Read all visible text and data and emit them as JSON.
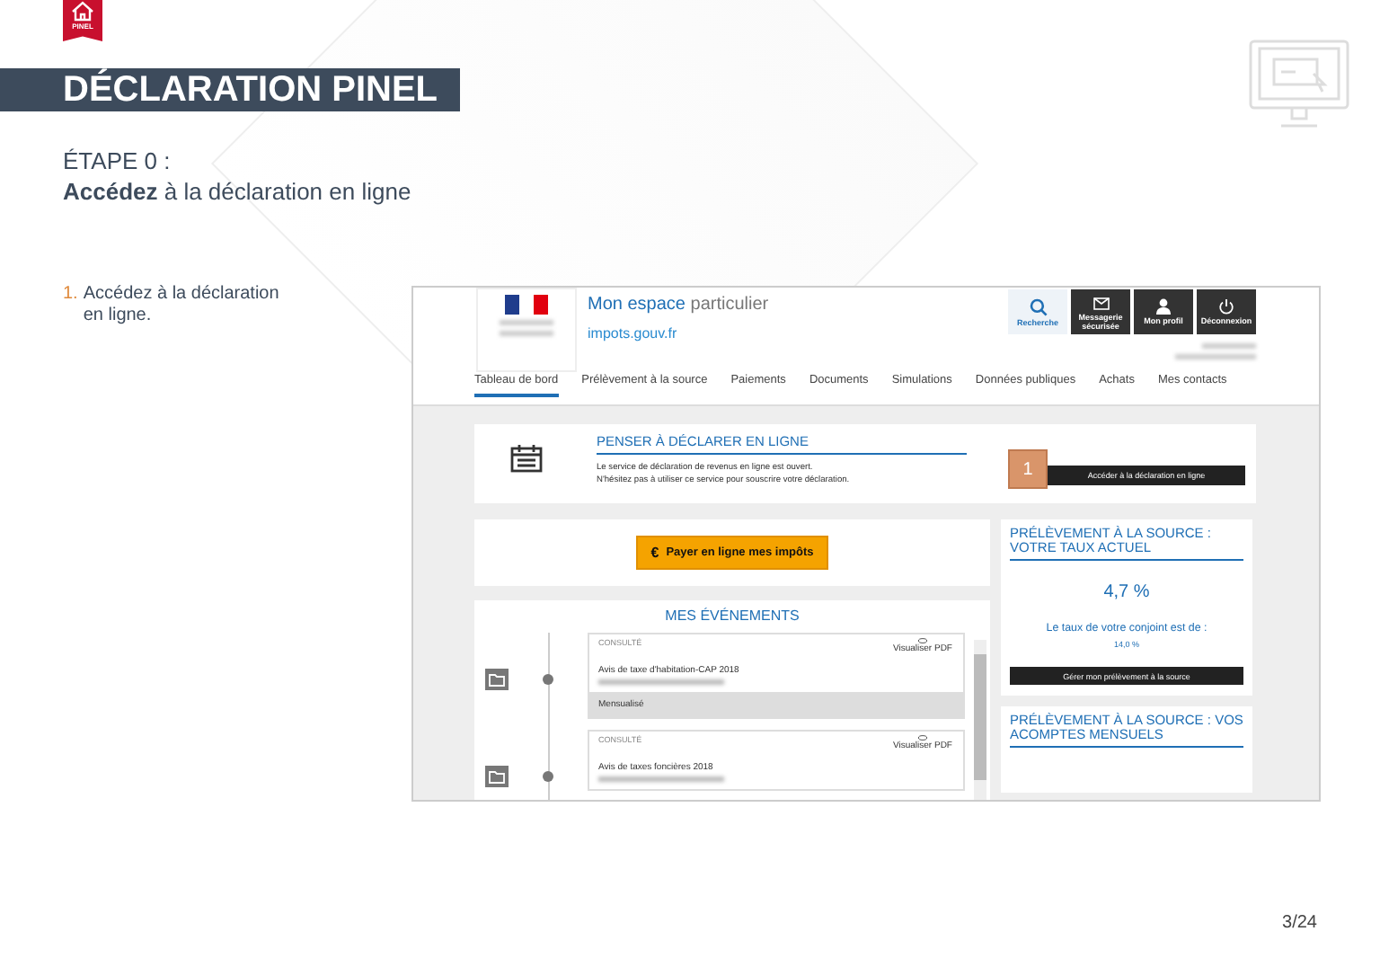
{
  "badge": {
    "label": "PINEL"
  },
  "title": "DÉCLARATION PINEL",
  "step": {
    "heading": "ÉTAPE 0 :",
    "subtitle": "**Accédez** à la déclaration en ligne"
  },
  "instructions": [
    {
      "number": "1.",
      "text": "Accédez à la déclaration en ligne."
    }
  ],
  "screenshot": {
    "header": {
      "site_title": "**Mon espace** particulier",
      "site_name": "impots.gouv.fr"
    },
    "header_buttons": [
      {
        "label": "Recherche",
        "kind": "search"
      },
      {
        "label": "Messagerie sécurisée",
        "kind": "mail"
      },
      {
        "label": "Mon profil",
        "kind": "profile"
      },
      {
        "label": "Déconnexion",
        "kind": "power"
      }
    ],
    "nav": [
      {
        "label": "Tableau de bord",
        "selected": true
      },
      {
        "label": "Prélèvement à la source",
        "selected": false
      },
      {
        "label": "Paiements",
        "selected": false
      },
      {
        "label": "Documents",
        "selected": false
      },
      {
        "label": "Simulations",
        "selected": false
      },
      {
        "label": "Données publiques",
        "selected": false
      },
      {
        "label": "Achats",
        "selected": false
      },
      {
        "label": "Mes contacts",
        "selected": false
      }
    ],
    "declare_card": {
      "title": "PENSER À DÉCLARER EN LIGNE",
      "text": [
        "Le service de déclaration de revenus en ligne est ouvert.",
        "N'hésitez pas à utiliser ce service pour souscrire votre déclaration."
      ],
      "step_badge": "1",
      "button": "Accéder à la déclaration en ligne"
    },
    "pay": {
      "icon": "€",
      "button": "Payer en ligne mes impôts"
    },
    "events": {
      "title": "MES ÉVÉNEMENTS",
      "items": [
        {
          "status": "CONSULTÉ",
          "action": "Visualiser PDF",
          "name": "Avis de taxe d'habitation-CAP 2018",
          "note": "Mensualisé"
        },
        {
          "status": "CONSULTÉ",
          "action": "Visualiser PDF",
          "name": "Avis de taxes foncières 2018"
        }
      ]
    },
    "rate_card": {
      "title": "PRÉLÈVEMENT À LA SOURCE : VOTRE TAUX ACTUEL",
      "rate": "4,7 %",
      "spouse_label": "Le taux de votre conjoint est de :",
      "spouse_rate": "14,0 %",
      "button": "Gérer mon prélèvement à la source"
    },
    "installments_card": {
      "title": "PRÉLÈVEMENT À LA SOURCE : VOS ACOMPTES MENSUELS"
    }
  },
  "page_number": "3/24"
}
